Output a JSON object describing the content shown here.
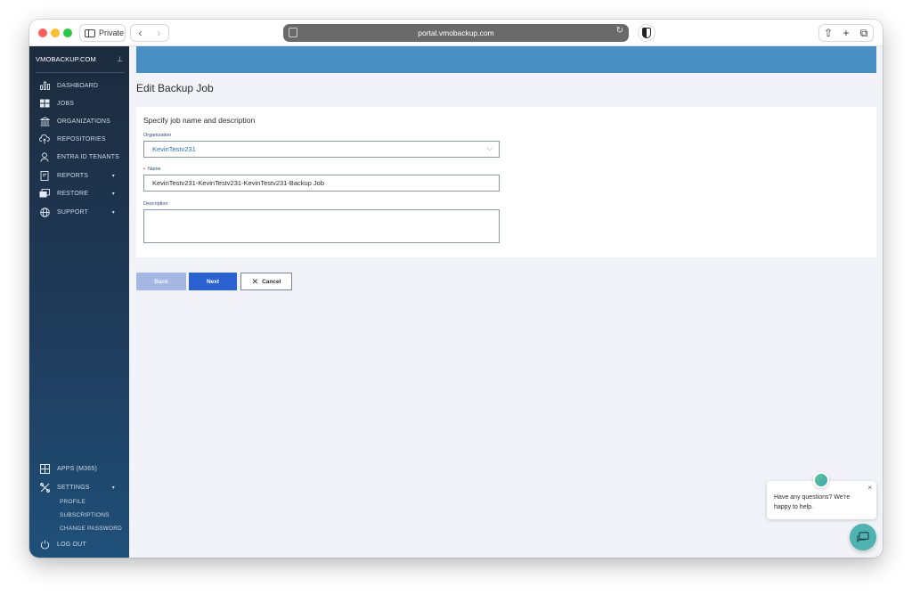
{
  "browser": {
    "private_label": "Private",
    "back": "‹",
    "forward": "›",
    "url": "portal.vmobackup.com",
    "reload": "↻",
    "share": "⇧",
    "new_tab": "+",
    "tabs": "⧉"
  },
  "sidebar": {
    "brand": "VMOBACKUP.COM",
    "items": [
      {
        "label": "DASHBOARD",
        "icon": "dashboard-icon"
      },
      {
        "label": "JOBS",
        "icon": "jobs-icon"
      },
      {
        "label": "ORGANIZATIONS",
        "icon": "bank-icon"
      },
      {
        "label": "REPOSITORIES",
        "icon": "cloud-upload-icon"
      },
      {
        "label": "ENTRA ID TENANTS",
        "icon": "user-icon"
      },
      {
        "label": "REPORTS",
        "icon": "report-icon"
      },
      {
        "label": "RESTORE",
        "icon": "restore-icon"
      },
      {
        "label": "SUPPORT",
        "icon": "support-icon"
      }
    ],
    "bottom": {
      "apps": "APPS (M365)",
      "settings": "SETTINGS",
      "profile": "PROFILE",
      "subscriptions": "SUBSCRIPTIONS",
      "change_password": "CHANGE PASSWORD",
      "logout": "LOG OUT"
    }
  },
  "main": {
    "page_title": "Edit Backup Job",
    "section_heading": "Specify job name and description",
    "organization": {
      "label": "Organization",
      "value": "KevinTestv231"
    },
    "name": {
      "label": "Name",
      "value": "KevinTestv231-KevinTestv231-KevinTestv231-Backup Job"
    },
    "description": {
      "label": "Description",
      "value": ""
    },
    "buttons": {
      "back": "Back",
      "next": "Next",
      "cancel": "Cancel"
    }
  },
  "chat": {
    "message": "Have any questions? We're happy to help.",
    "close": "×"
  },
  "colors": {
    "accent": "#4a8fc4",
    "primary_button": "#2a62d2",
    "sidebar_top": "#1d2b3d",
    "chat": "#4fb3b2"
  }
}
